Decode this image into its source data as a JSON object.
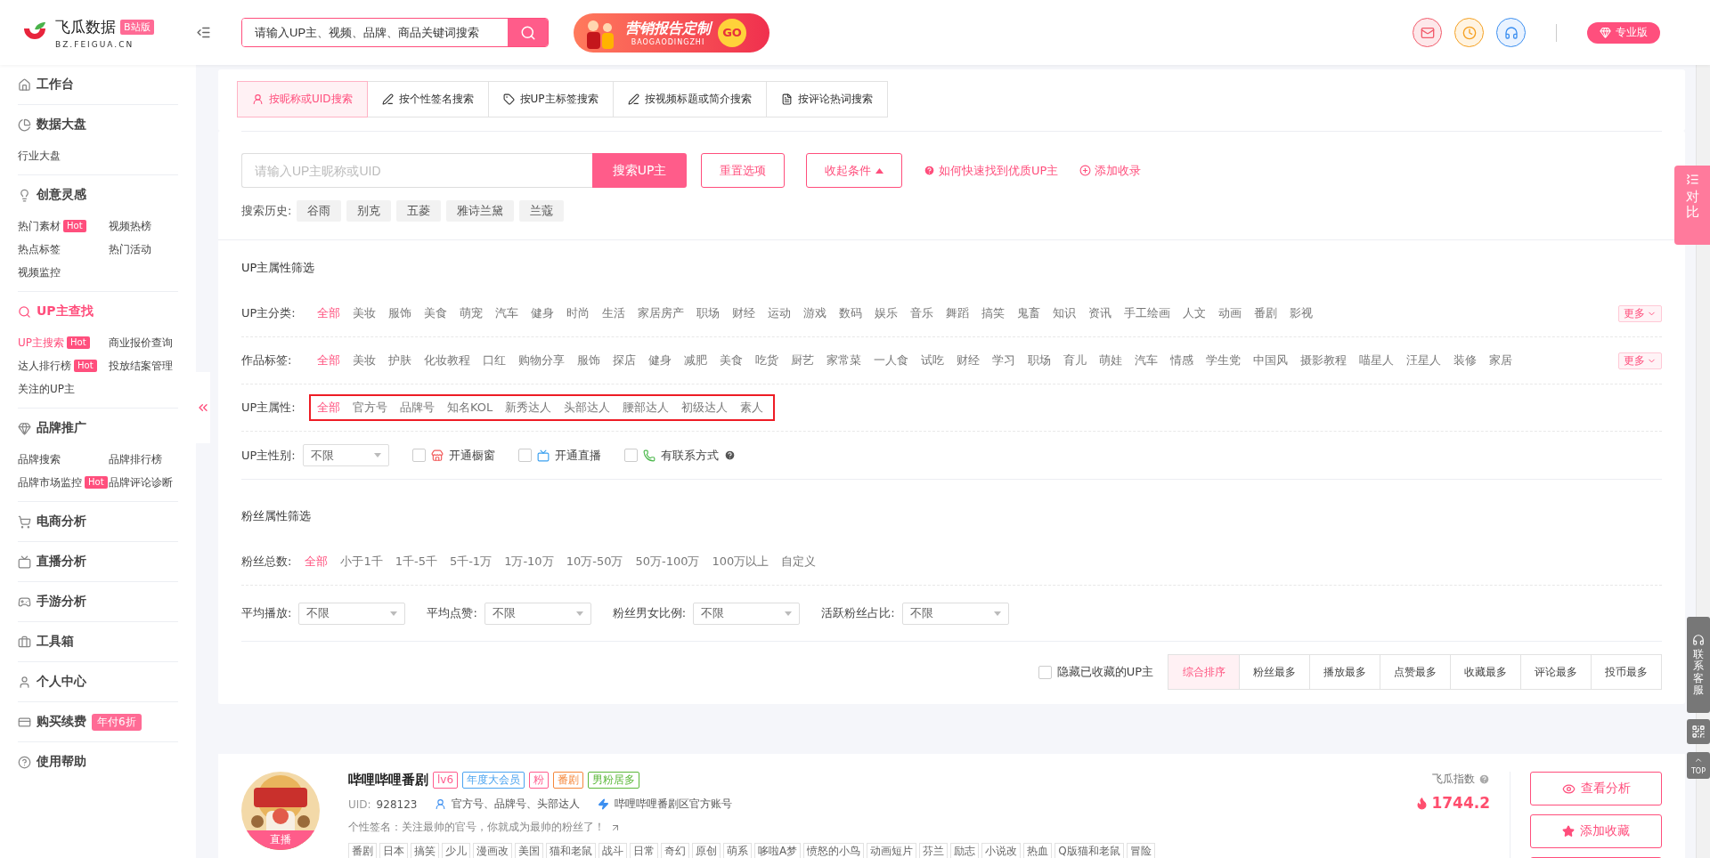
{
  "header": {
    "logo": {
      "name": "飞瓜数据",
      "badge": "B站版",
      "domain": "BZ.FEIGUA.CN"
    },
    "search": {
      "placeholder": "请输入UP主、视频、品牌、商品关键词搜索"
    },
    "banner": {
      "title": "营销报告定制",
      "subtitle": "BAOGAODINGZHI",
      "go": "GO"
    },
    "pro_button": "专业版"
  },
  "sidebar": {
    "sections": [
      {
        "title": "工作台",
        "selected": false
      },
      {
        "title": "数据大盘",
        "selected": false,
        "items": [
          {
            "label": "行业大盘",
            "selected": false
          }
        ]
      },
      {
        "title": "创意灵感",
        "selected": false,
        "items": [
          {
            "label": "热门素材",
            "badge": "Hot",
            "selected": false
          },
          {
            "label": "视频热榜",
            "selected": false
          },
          {
            "label": "热点标签",
            "selected": false
          },
          {
            "label": "热门活动",
            "selected": false
          },
          {
            "label": "视频监控",
            "selected": false
          }
        ]
      },
      {
        "title": "UP主查找",
        "selected": true,
        "items": [
          {
            "label": "UP主搜索",
            "badge": "Hot",
            "selected": true
          },
          {
            "label": "商业报价查询",
            "selected": false
          },
          {
            "label": "达人排行榜",
            "badge": "Hot",
            "selected": false
          },
          {
            "label": "投放结案管理",
            "selected": false
          },
          {
            "label": "关注的UP主",
            "selected": false
          }
        ]
      },
      {
        "title": "品牌推广",
        "selected": false,
        "items": [
          {
            "label": "品牌搜索",
            "selected": false
          },
          {
            "label": "品牌排行榜",
            "selected": false
          },
          {
            "label": "品牌市场监控",
            "badge": "Hot",
            "selected": false
          },
          {
            "label": "品牌评论诊断",
            "selected": false
          }
        ]
      },
      {
        "title": "电商分析",
        "selected": false
      },
      {
        "title": "直播分析",
        "selected": false
      },
      {
        "title": "手游分析",
        "selected": false
      },
      {
        "title": "工具箱",
        "selected": false
      },
      {
        "title": "个人中心",
        "selected": false
      },
      {
        "title": "购买续费",
        "selected": false,
        "badge": "年付6折"
      },
      {
        "title": "使用帮助",
        "selected": false
      }
    ]
  },
  "search_tabs": [
    {
      "label": "按昵称或UID搜索",
      "selected": true
    },
    {
      "label": "按个性签名搜索",
      "selected": false
    },
    {
      "label": "按UP主标签搜索",
      "selected": false
    },
    {
      "label": "按视频标题或简介搜索",
      "selected": false
    },
    {
      "label": "按评论热词搜索",
      "selected": false
    }
  ],
  "search": {
    "placeholder": "请输入UP主昵称或UID",
    "button": "搜索UP主",
    "reset": "重置选项",
    "collapse": "收起条件",
    "help_link": "如何快速找到优质UP主",
    "add_link": "添加收录",
    "history_label": "搜索历史:",
    "history": [
      "谷雨",
      "别克",
      "五菱",
      "雅诗兰黛",
      "兰蔻"
    ]
  },
  "up_filters": {
    "title": "UP主属性筛选",
    "rows": [
      {
        "label": "UP主分类:",
        "more": "更多",
        "highlighted": false,
        "options": [
          {
            "label": "全部",
            "selected": true
          },
          {
            "label": "美妆",
            "selected": false
          },
          {
            "label": "服饰",
            "selected": false
          },
          {
            "label": "美食",
            "selected": false
          },
          {
            "label": "萌宠",
            "selected": false
          },
          {
            "label": "汽车",
            "selected": false
          },
          {
            "label": "健身",
            "selected": false
          },
          {
            "label": "时尚",
            "selected": false
          },
          {
            "label": "生活",
            "selected": false
          },
          {
            "label": "家居房产",
            "selected": false
          },
          {
            "label": "职场",
            "selected": false
          },
          {
            "label": "财经",
            "selected": false
          },
          {
            "label": "运动",
            "selected": false
          },
          {
            "label": "游戏",
            "selected": false
          },
          {
            "label": "数码",
            "selected": false
          },
          {
            "label": "娱乐",
            "selected": false
          },
          {
            "label": "音乐",
            "selected": false
          },
          {
            "label": "舞蹈",
            "selected": false
          },
          {
            "label": "搞笑",
            "selected": false
          },
          {
            "label": "鬼畜",
            "selected": false
          },
          {
            "label": "知识",
            "selected": false
          },
          {
            "label": "资讯",
            "selected": false
          },
          {
            "label": "手工绘画",
            "selected": false
          },
          {
            "label": "人文",
            "selected": false
          },
          {
            "label": "动画",
            "selected": false
          },
          {
            "label": "番剧",
            "selected": false
          },
          {
            "label": "影视",
            "selected": false
          }
        ]
      },
      {
        "label": "作品标签:",
        "more": "更多",
        "highlighted": false,
        "options": [
          {
            "label": "全部",
            "selected": true
          },
          {
            "label": "美妆",
            "selected": false
          },
          {
            "label": "护肤",
            "selected": false
          },
          {
            "label": "化妆教程",
            "selected": false
          },
          {
            "label": "口红",
            "selected": false
          },
          {
            "label": "购物分享",
            "selected": false
          },
          {
            "label": "服饰",
            "selected": false
          },
          {
            "label": "探店",
            "selected": false
          },
          {
            "label": "健身",
            "selected": false
          },
          {
            "label": "减肥",
            "selected": false
          },
          {
            "label": "美食",
            "selected": false
          },
          {
            "label": "吃货",
            "selected": false
          },
          {
            "label": "厨艺",
            "selected": false
          },
          {
            "label": "家常菜",
            "selected": false
          },
          {
            "label": "一人食",
            "selected": false
          },
          {
            "label": "试吃",
            "selected": false
          },
          {
            "label": "财经",
            "selected": false
          },
          {
            "label": "学习",
            "selected": false
          },
          {
            "label": "职场",
            "selected": false
          },
          {
            "label": "育儿",
            "selected": false
          },
          {
            "label": "萌娃",
            "selected": false
          },
          {
            "label": "汽车",
            "selected": false
          },
          {
            "label": "情感",
            "selected": false
          },
          {
            "label": "学生党",
            "selected": false
          },
          {
            "label": "中国风",
            "selected": false
          },
          {
            "label": "摄影教程",
            "selected": false
          },
          {
            "label": "喵星人",
            "selected": false
          },
          {
            "label": "汪星人",
            "selected": false
          },
          {
            "label": "装修",
            "selected": false
          },
          {
            "label": "家居",
            "selected": false
          }
        ]
      },
      {
        "label": "UP主属性:",
        "highlighted": true,
        "options": [
          {
            "label": "全部",
            "selected": true
          },
          {
            "label": "官方号",
            "selected": false
          },
          {
            "label": "品牌号",
            "selected": false
          },
          {
            "label": "知名KOL",
            "selected": false
          },
          {
            "label": "新秀达人",
            "selected": false
          },
          {
            "label": "头部达人",
            "selected": false
          },
          {
            "label": "腰部达人",
            "selected": false
          },
          {
            "label": "初级达人",
            "selected": false
          },
          {
            "label": "素人",
            "selected": false
          }
        ]
      }
    ],
    "gender": {
      "label": "UP主性别:",
      "value": "不限"
    },
    "checkboxes": [
      {
        "label": "开通橱窗",
        "checked": false
      },
      {
        "label": "开通直播",
        "checked": false
      },
      {
        "label": "有联系方式",
        "checked": false
      }
    ]
  },
  "fan_filters": {
    "title": "粉丝属性筛选",
    "count": {
      "label": "粉丝总数:",
      "options": [
        {
          "label": "全部",
          "selected": true
        },
        {
          "label": "小于1千",
          "selected": false
        },
        {
          "label": "1千-5千",
          "selected": false
        },
        {
          "label": "5千-1万",
          "selected": false
        },
        {
          "label": "1万-10万",
          "selected": false
        },
        {
          "label": "10万-50万",
          "selected": false
        },
        {
          "label": "50万-100万",
          "selected": false
        },
        {
          "label": "100万以上",
          "selected": false
        },
        {
          "label": "自定义",
          "selected": false
        }
      ]
    },
    "selects": [
      {
        "label": "平均播放:",
        "value": "不限"
      },
      {
        "label": "平均点赞:",
        "value": "不限"
      },
      {
        "label": "粉丝男女比例:",
        "value": "不限"
      },
      {
        "label": "活跃粉丝占比:",
        "value": "不限"
      }
    ]
  },
  "sort": {
    "hide_collected": {
      "label": "隐藏已收藏的UP主",
      "checked": false
    },
    "options": [
      {
        "label": "综合排序",
        "selected": true
      },
      {
        "label": "粉丝最多",
        "selected": false
      },
      {
        "label": "播放最多",
        "selected": false
      },
      {
        "label": "点赞最多",
        "selected": false
      },
      {
        "label": "收藏最多",
        "selected": false
      },
      {
        "label": "评论最多",
        "selected": false
      },
      {
        "label": "投币最多",
        "selected": false
      }
    ]
  },
  "result": {
    "avatar_badge": "直播",
    "name": "哔哩哔哩番剧",
    "badges": [
      {
        "label": "lv6",
        "color": "#ff5c8d"
      },
      {
        "label": "年度大会员",
        "color": "#4aa3f0"
      },
      {
        "label": "粉",
        "color": "#ff5c8d"
      },
      {
        "label": "番剧",
        "color": "#f5873a"
      },
      {
        "label": "男粉居多",
        "color": "#5cb83a"
      }
    ],
    "uid_label": "UID:",
    "uid": "928123",
    "attributes": "官方号、品牌号、头部达人",
    "zone": "哔哩哔哩番剧区官方账号",
    "signature": "个性签名：关注最帅的官号，你就成为最帅的粉丝了！",
    "tags": [
      "番剧",
      "日本",
      "搞笑",
      "少儿",
      "漫画改",
      "美国",
      "猫和老鼠",
      "战斗",
      "日常",
      "奇幻",
      "原创",
      "萌系",
      "哆啦A梦",
      "愤怒的小鸟",
      "动画短片",
      "芬兰",
      "励志",
      "小说改",
      "热血",
      "Q版猫和老鼠",
      "冒险"
    ],
    "index_label": "飞瓜指数",
    "index_value": "1744.2",
    "buttons": [
      "查看分析",
      "添加收藏"
    ]
  },
  "float": {
    "compare": "对比",
    "contact": "联系客服",
    "top": "TOP"
  }
}
